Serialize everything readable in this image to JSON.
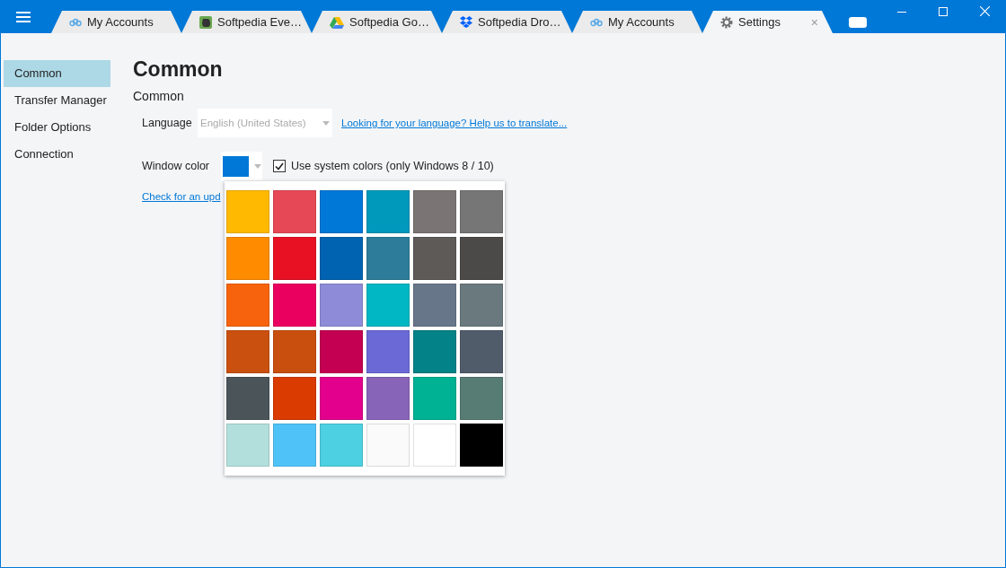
{
  "tabs": [
    {
      "label": "My Accounts",
      "kind": "accounts",
      "selected": false
    },
    {
      "label": "Softpedia Eve…",
      "kind": "notes",
      "selected": false
    },
    {
      "label": "Softpedia Go…",
      "kind": "drive",
      "selected": false
    },
    {
      "label": "Softpedia Dro…",
      "kind": "boxes",
      "selected": false
    },
    {
      "label": "My Accounts",
      "kind": "accounts",
      "selected": false
    },
    {
      "label": "Settings",
      "kind": "settings",
      "selected": true,
      "close": "×"
    }
  ],
  "sidebar": {
    "items": [
      {
        "label": "Common",
        "selected": true
      },
      {
        "label": "Transfer Manager",
        "selected": false
      },
      {
        "label": "Folder Options",
        "selected": false
      },
      {
        "label": "Connection",
        "selected": false
      }
    ]
  },
  "page": {
    "title": "Common",
    "section": "Common",
    "language": {
      "label": "Language",
      "value": "English (United States)",
      "disabled": true
    },
    "translate_link": "Looking for your language? Help us to translate...",
    "window_color": {
      "label": "Window color",
      "color": "#0078d7"
    },
    "system_colors": {
      "label": "Use system colors (only Windows 8 / 10)",
      "checked": true
    },
    "update_link": "Check for an upd",
    "palette": [
      {
        "color": "#ffb900"
      },
      {
        "color": "#e74856"
      },
      {
        "color": "#0078d7"
      },
      {
        "color": "#0099bc"
      },
      {
        "color": "#7a7574"
      },
      {
        "color": "#767676"
      },
      {
        "color": "#ff8c00"
      },
      {
        "color": "#e81123"
      },
      {
        "color": "#0063b1"
      },
      {
        "color": "#2d7d9a"
      },
      {
        "color": "#5d5a58"
      },
      {
        "color": "#4c4a48"
      },
      {
        "color": "#f7630c"
      },
      {
        "color": "#ea005e"
      },
      {
        "color": "#8e8cd8"
      },
      {
        "color": "#00b7c3"
      },
      {
        "color": "#68768a"
      },
      {
        "color": "#69797e"
      },
      {
        "color": "#ca5010"
      },
      {
        "color": "#c94f0f"
      },
      {
        "color": "#c30052"
      },
      {
        "color": "#6b69d6"
      },
      {
        "color": "#038387"
      },
      {
        "color": "#515c6b"
      },
      {
        "color": "#4a5459"
      },
      {
        "color": "#da3b01"
      },
      {
        "color": "#e3008c"
      },
      {
        "color": "#8764b8"
      },
      {
        "color": "#00b294"
      },
      {
        "color": "#567c73"
      },
      {
        "color": "#b2dfdb"
      },
      {
        "color": "#4fc3f7"
      },
      {
        "color": "#4dd0e1"
      },
      {
        "color": "#fafafa"
      },
      {
        "color": "#ffffff"
      },
      {
        "color": "#000000"
      }
    ]
  }
}
